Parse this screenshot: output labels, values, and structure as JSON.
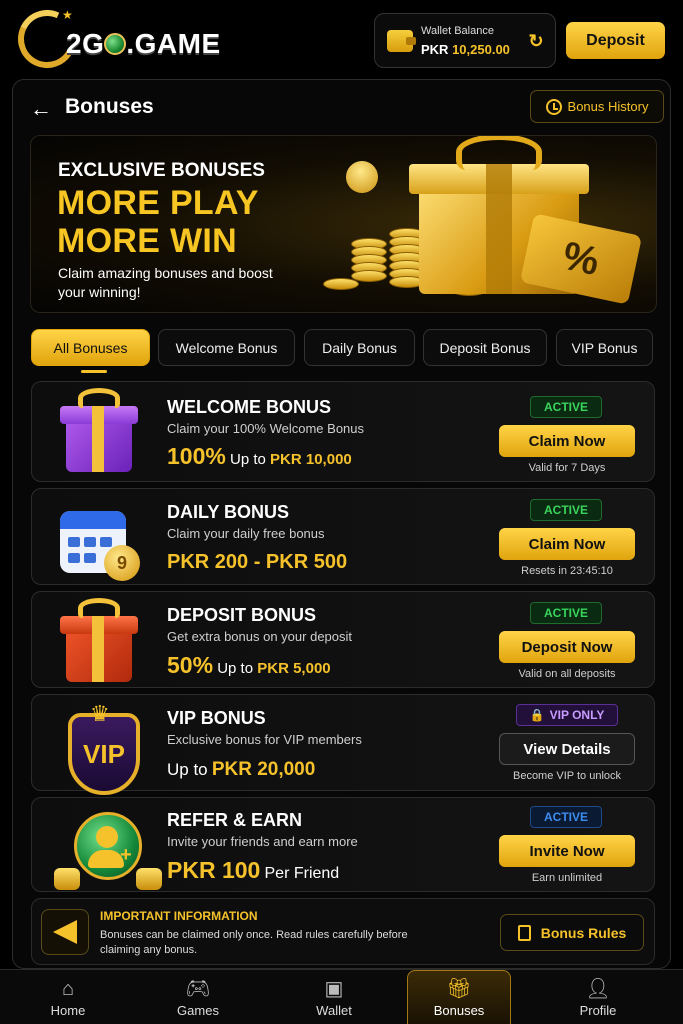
{
  "header": {
    "logo_text": ".GAME",
    "logo_brand": "2G",
    "wallet_label": "Wallet Balance",
    "wallet_currency": "PKR",
    "wallet_amount": "10,250.00",
    "deposit_label": "Deposit"
  },
  "page": {
    "title": "Bonuses",
    "history_label": "Bonus History"
  },
  "banner": {
    "kicker": "EXCLUSIVE BONUSES",
    "headline_1": "MORE PLAY",
    "headline_2": "MORE WIN",
    "subtitle": "Claim amazing bonuses and boost your winning!",
    "ticket_symbol": "%"
  },
  "tabs": [
    {
      "label": "All Bonuses"
    },
    {
      "label": "Welcome Bonus"
    },
    {
      "label": "Daily Bonus"
    },
    {
      "label": "Deposit Bonus"
    },
    {
      "label": "VIP Bonus"
    }
  ],
  "cards": [
    {
      "title": "WELCOME BONUS",
      "desc": "Claim your 100% Welcome Bonus",
      "amount_main": "100%",
      "amount_prefix": "Up to",
      "amount_value": "PKR 10,000",
      "badge": "ACTIVE",
      "button": "Claim Now",
      "note": "Valid for 7 Days"
    },
    {
      "title": "DAILY BONUS",
      "desc": "Claim your daily free bonus",
      "amount_main": "PKR 200 - PKR 500",
      "badge": "ACTIVE",
      "button": "Claim Now",
      "note": "Resets in 23:45:10",
      "coin_label": "9"
    },
    {
      "title": "DEPOSIT BONUS",
      "desc": "Get extra bonus on your deposit",
      "amount_main": "50%",
      "amount_prefix": "Up to",
      "amount_value": "PKR 5,000",
      "badge": "ACTIVE",
      "button": "Deposit Now",
      "note": "Valid on all deposits"
    },
    {
      "title": "VIP BONUS",
      "desc": "Exclusive bonus for VIP members",
      "amount_prefix": "Up to",
      "amount_main": "PKR 20,000",
      "badge": "VIP ONLY",
      "button": "View Details",
      "note": "Become VIP to unlock",
      "shield_label": "VIP"
    },
    {
      "title": "REFER & EARN",
      "desc": "Invite your friends and earn more",
      "amount_main": "PKR 100",
      "amount_suffix": "Per Friend",
      "badge": "ACTIVE",
      "button": "Invite Now",
      "note": "Earn unlimited"
    }
  ],
  "info": {
    "title": "IMPORTANT INFORMATION",
    "text": "Bonuses can be claimed only once. Read rules carefully before claiming any bonus.",
    "rules_label": "Bonus Rules"
  },
  "nav": [
    {
      "label": "Home",
      "icon": "home-icon"
    },
    {
      "label": "Games",
      "icon": "gamepad-icon"
    },
    {
      "label": "Wallet",
      "icon": "wallet-icon"
    },
    {
      "label": "Bonuses",
      "icon": "gift-icon"
    },
    {
      "label": "Profile",
      "icon": "profile-icon"
    }
  ],
  "colors": {
    "accent": "#f5c22b",
    "background": "#000000",
    "active_green": "#39d45a",
    "active_blue": "#3d8cf0",
    "vip_purple": "#c79bff"
  }
}
